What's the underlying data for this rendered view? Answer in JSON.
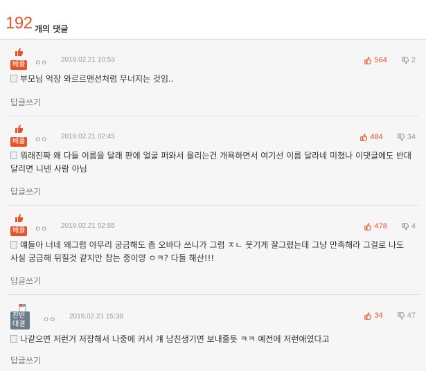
{
  "header": {
    "count": "192",
    "count_label": "개의 댓글"
  },
  "comments": [
    {
      "badge": "베플",
      "user": "ㅇㅇ",
      "date": "2019.02.21 10:53",
      "up": "564",
      "down": "2",
      "text": "부모님 억장 와르르맨션처럼 무너지는 것임..",
      "reply": "답글쓰기"
    },
    {
      "badge": "베플",
      "user": "ㅇㅇ",
      "date": "2019.02.21 02:45",
      "up": "484",
      "down": "34",
      "text": "뭐래진짜 왜 다들 이름을 달래 판에 얼굴 퍼와서 올리는건 개욕하면서 여기선 이름 달라네 미쳤나 이댓글에도 반대달리면 니넨 사람 아님",
      "reply": "답글쓰기"
    },
    {
      "badge": "베플",
      "user": "ㅇㅇ",
      "date": "2019.02.21 02:55",
      "up": "478",
      "down": "4",
      "text": "얘들아 너네 왜그럼 아무리 궁금해도 좀 오바다 쓰니가 그럼 ㅈㄴ 웃기게 잘그렸는데 그냥 만족해라 그걸로 나도 사실 궁금해 뒤질것 같지만 참는 중이양 ㅇㅋ? 다들 해산!!!",
      "reply": "답글쓰기"
    },
    {
      "badge": "찬반대결",
      "user": "ㅇㅇ",
      "date": "2019.02.21 15:38",
      "up": "34",
      "down": "47",
      "text": "나같으면 저런거 저장해서 나중에 커서 걔 남친생기면 보내줄듯 ㅋㅋ 예전에 저런애였다고",
      "reply": "답글쓰기"
    }
  ]
}
